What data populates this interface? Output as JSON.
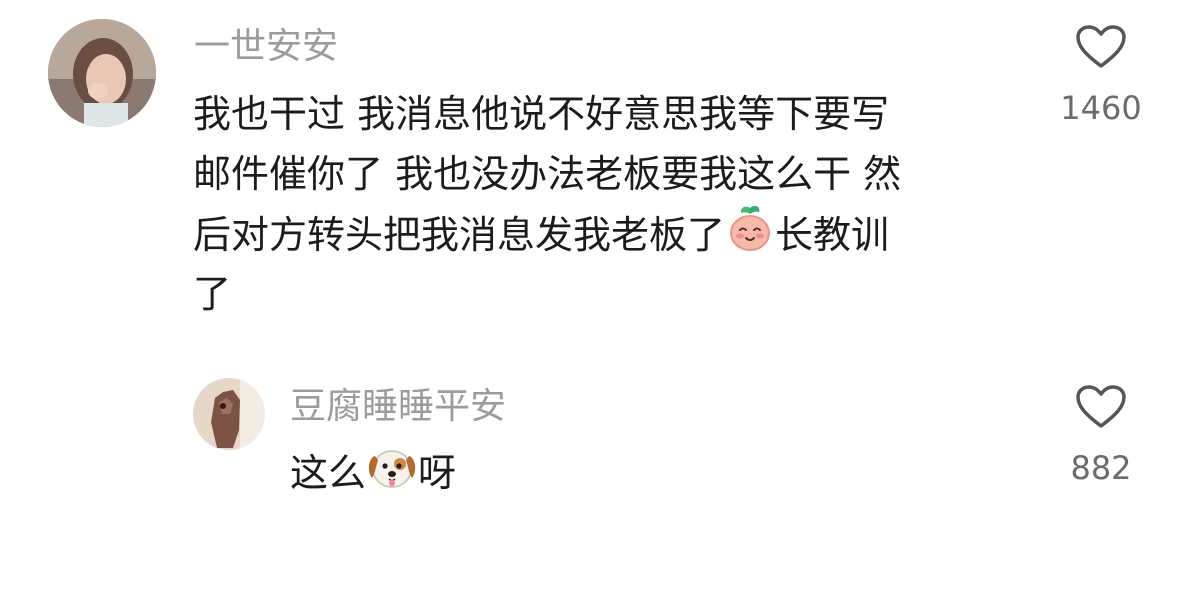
{
  "comments": [
    {
      "username": "一世安安",
      "text_lines": [
        "我也干过 我消息他说不好意思我等下要写",
        "邮件催你了 我也没办法老板要我这么干 然",
        "后对方转头把我消息发我老板了",
        "长教训",
        "了"
      ],
      "emoji": "peach-face-emoji",
      "like_count": "1460",
      "like_icon": "heart-outline-icon"
    },
    {
      "username": "豆腐睡睡平安",
      "text_before": "这么",
      "text_after": "呀",
      "emoji": "dog-face-emoji",
      "like_count": "882",
      "like_icon": "heart-outline-icon"
    }
  ],
  "colors": {
    "username": "#9c9c9c",
    "text": "#1c1c1c",
    "count": "#6b6b6b",
    "icon": "#555555"
  }
}
